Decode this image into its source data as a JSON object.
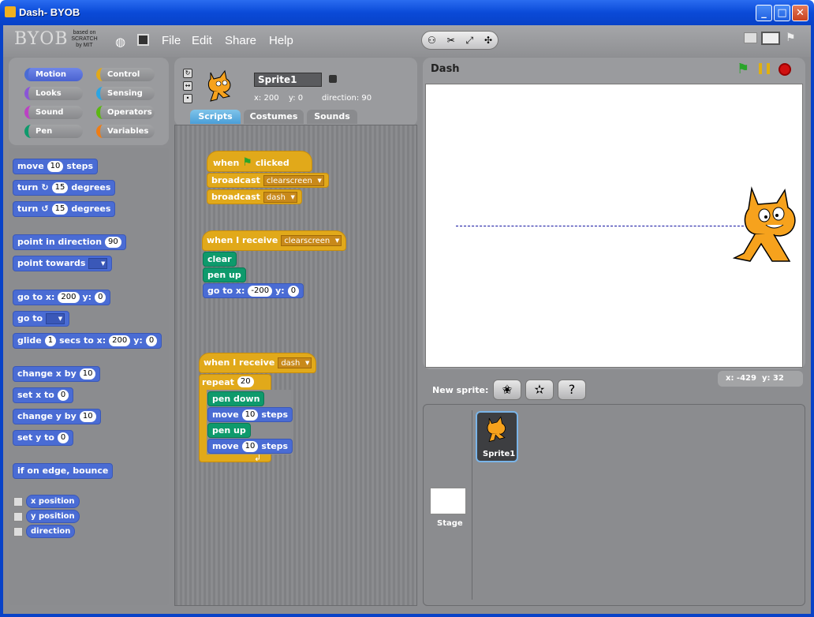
{
  "window": {
    "title": "Dash- BYOB",
    "min": "_",
    "max": "□",
    "close": "✕"
  },
  "logo": {
    "name": "BYOB",
    "tag": "based on SCRATCH by MIT"
  },
  "menu": [
    "File",
    "Edit",
    "Share",
    "Help"
  ],
  "categories": [
    {
      "label": "Motion",
      "color": "#4a6cd4",
      "selected": true
    },
    {
      "label": "Control",
      "color": "#e1a91a"
    },
    {
      "label": "Looks",
      "color": "#8a55d7"
    },
    {
      "label": "Sensing",
      "color": "#2ca5e2"
    },
    {
      "label": "Sound",
      "color": "#bb42c3"
    },
    {
      "label": "Operators",
      "color": "#5cb712"
    },
    {
      "label": "Pen",
      "color": "#0e9a6c"
    },
    {
      "label": "Variables",
      "color": "#ee7d16"
    }
  ],
  "palette": {
    "move": "move",
    "steps": "steps",
    "move_n": "10",
    "turn": "turn",
    "degrees": "degrees",
    "turn_r": "15",
    "turn_l": "15",
    "point_dir": "point in direction",
    "dir_val": "90",
    "point_towards": "point towards",
    "goto_xy": "go to x:",
    "goto_x": "200",
    "y": "y:",
    "goto_y": "0",
    "goto": "go to",
    "glide": "glide",
    "glide_n": "1",
    "secs_to": "secs to x:",
    "glide_x": "200",
    "glide_y": "0",
    "change_x": "change x by",
    "change_x_n": "10",
    "set_x": "set x to",
    "set_x_n": "0",
    "change_y": "change y by",
    "change_y_n": "10",
    "set_y": "set y to",
    "set_y_n": "0",
    "bounce": "if on edge, bounce",
    "xpos": "x position",
    "ypos": "y position",
    "direction": "direction"
  },
  "sprite": {
    "name": "Sprite1",
    "x": "x: 200",
    "y": "y: 0",
    "dir": "direction: 90"
  },
  "tabs": [
    "Scripts",
    "Costumes",
    "Sounds"
  ],
  "scripts": {
    "when": "when",
    "clicked": "clicked",
    "broadcast": "broadcast",
    "clearscreen": "clearscreen",
    "dash": "dash",
    "when_receive": "when I receive",
    "clear": "clear",
    "pen_up": "pen up",
    "pen_down": "pen down",
    "goto_x": "go to x:",
    "gx": "-200",
    "y": "y:",
    "gy": "0",
    "repeat": "repeat",
    "rep_n": "20",
    "move": "move",
    "move_n": "10",
    "steps": "steps"
  },
  "stage": {
    "title": "Dash",
    "mouse_x": "x: -429",
    "mouse_y": "y: 32"
  },
  "new_sprite": "New sprite:",
  "sprites_pane": {
    "sprite_label": "Sprite1",
    "stage_label": "Stage"
  }
}
